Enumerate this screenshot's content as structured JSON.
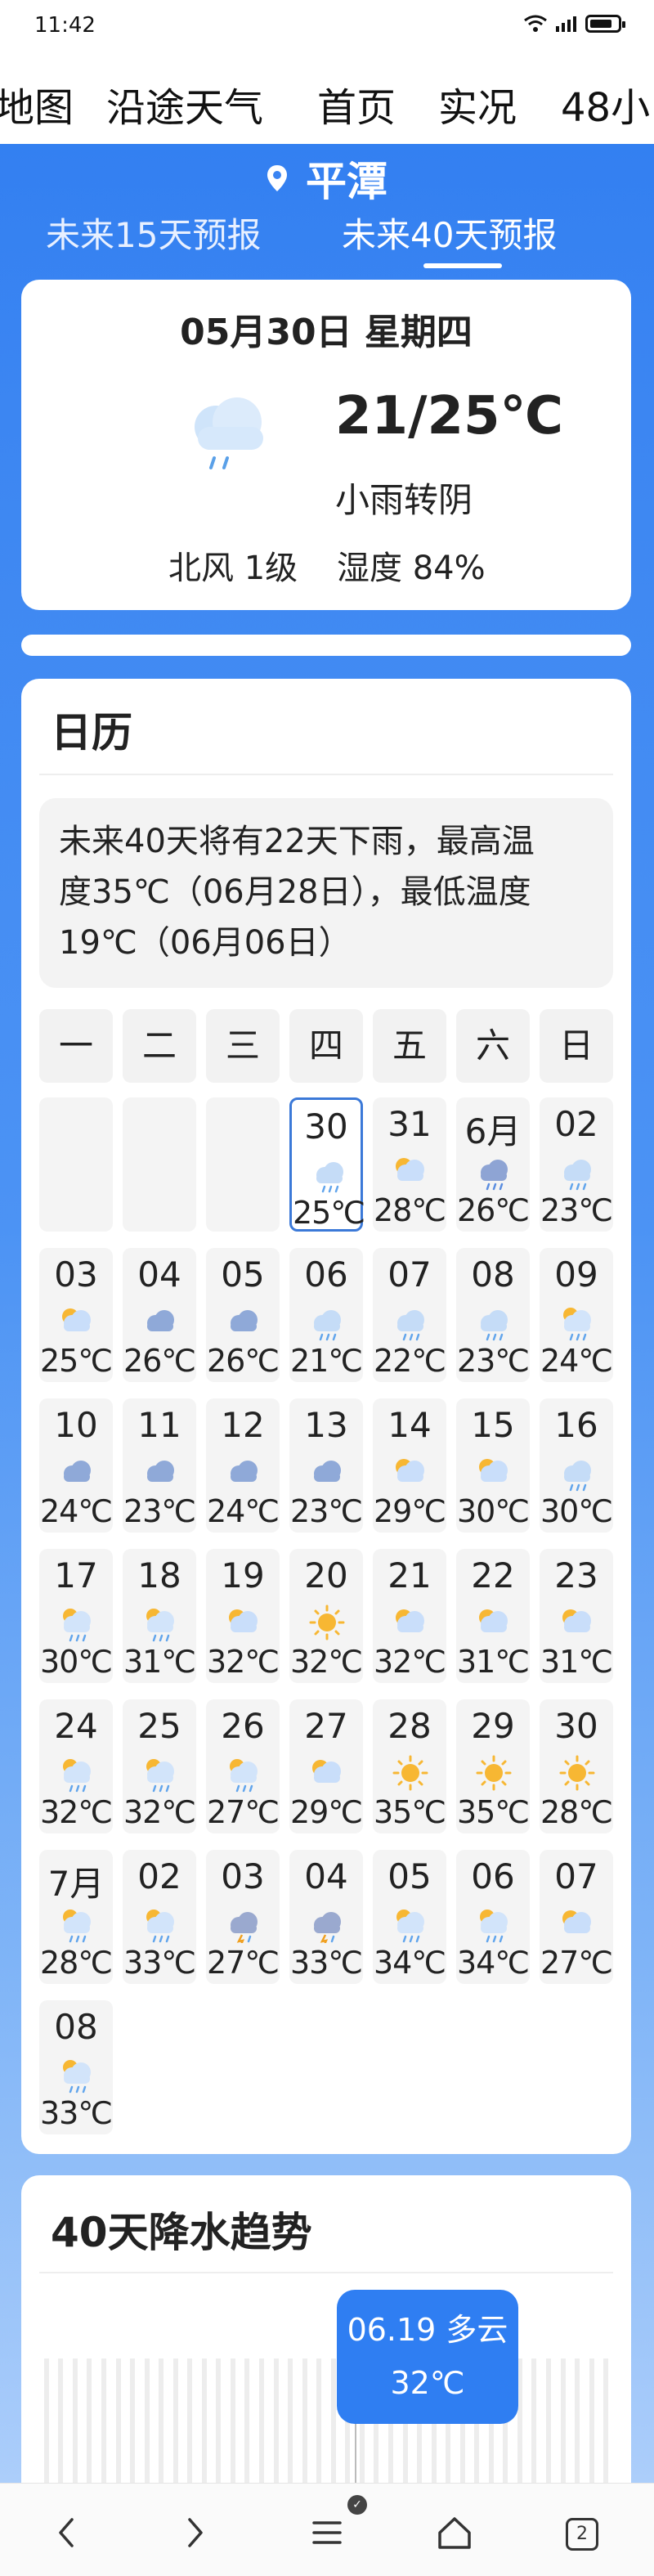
{
  "status_bar": {
    "time": "11:42"
  },
  "top_tabs": [
    "地图",
    "沿途天气",
    "首页",
    "实况",
    "48小"
  ],
  "location": "平潭",
  "forecast_tabs": [
    "未来15天预报",
    "未来40天预报"
  ],
  "today": {
    "date": "05月30日 星期四",
    "temp": "21/25℃",
    "condition": "小雨转阴",
    "wind": "北风 1级",
    "humidity": "湿度 84%",
    "icon": "light-rain-icon"
  },
  "calendar": {
    "title": "日历",
    "summary": "未来40天将有22天下雨，最高温度35℃（06月28日），最低温度19℃（06月06日）",
    "summary_lines": [
      "未来40天将有22天下雨，最高温",
      "度35℃（06月28日），最低温度",
      "19℃（06月06日）"
    ],
    "weekdays": [
      "一",
      "二",
      "三",
      "四",
      "五",
      "六",
      "日"
    ],
    "leading_empty": 3,
    "days": [
      {
        "label": "30",
        "temp": "25℃",
        "icon": "light-rain-icon",
        "selected": true
      },
      {
        "label": "31",
        "temp": "28℃",
        "icon": "partly-cloudy-icon"
      },
      {
        "label": "6月",
        "temp": "26℃",
        "icon": "rain-icon"
      },
      {
        "label": "02",
        "temp": "23℃",
        "icon": "light-rain-icon"
      },
      {
        "label": "03",
        "temp": "25℃",
        "icon": "partly-cloudy-icon"
      },
      {
        "label": "04",
        "temp": "26℃",
        "icon": "cloudy-icon"
      },
      {
        "label": "05",
        "temp": "26℃",
        "icon": "cloudy-icon"
      },
      {
        "label": "06",
        "temp": "21℃",
        "icon": "light-rain-icon"
      },
      {
        "label": "07",
        "temp": "22℃",
        "icon": "light-rain-icon"
      },
      {
        "label": "08",
        "temp": "23℃",
        "icon": "light-rain-icon"
      },
      {
        "label": "09",
        "temp": "24℃",
        "icon": "sun-rain-icon"
      },
      {
        "label": "10",
        "temp": "24℃",
        "icon": "cloudy-icon"
      },
      {
        "label": "11",
        "temp": "23℃",
        "icon": "cloudy-icon"
      },
      {
        "label": "12",
        "temp": "24℃",
        "icon": "cloudy-icon"
      },
      {
        "label": "13",
        "temp": "23℃",
        "icon": "cloudy-icon"
      },
      {
        "label": "14",
        "temp": "29℃",
        "icon": "partly-cloudy-icon"
      },
      {
        "label": "15",
        "temp": "30℃",
        "icon": "partly-cloudy-icon"
      },
      {
        "label": "16",
        "temp": "30℃",
        "icon": "light-rain-icon"
      },
      {
        "label": "17",
        "temp": "30℃",
        "icon": "sun-rain-icon"
      },
      {
        "label": "18",
        "temp": "31℃",
        "icon": "sun-rain-icon"
      },
      {
        "label": "19",
        "temp": "32℃",
        "icon": "partly-cloudy-icon"
      },
      {
        "label": "20",
        "temp": "32℃",
        "icon": "sun-icon"
      },
      {
        "label": "21",
        "temp": "32℃",
        "icon": "partly-cloudy-icon"
      },
      {
        "label": "22",
        "temp": "31℃",
        "icon": "partly-cloudy-icon"
      },
      {
        "label": "23",
        "temp": "31℃",
        "icon": "partly-cloudy-icon"
      },
      {
        "label": "24",
        "temp": "32℃",
        "icon": "sun-rain-icon"
      },
      {
        "label": "25",
        "temp": "32℃",
        "icon": "sun-rain-icon"
      },
      {
        "label": "26",
        "temp": "27℃",
        "icon": "sun-rain-icon"
      },
      {
        "label": "27",
        "temp": "29℃",
        "icon": "partly-cloudy-icon"
      },
      {
        "label": "28",
        "temp": "35℃",
        "icon": "sun-icon"
      },
      {
        "label": "29",
        "temp": "35℃",
        "icon": "sun-icon"
      },
      {
        "label": "30",
        "temp": "28℃",
        "icon": "sun-icon"
      },
      {
        "label": "7月",
        "temp": "28℃",
        "icon": "sun-rain-icon"
      },
      {
        "label": "02",
        "temp": "33℃",
        "icon": "sun-rain-icon"
      },
      {
        "label": "03",
        "temp": "27℃",
        "icon": "thunderstorm-icon"
      },
      {
        "label": "04",
        "temp": "33℃",
        "icon": "thunderstorm-icon"
      },
      {
        "label": "05",
        "temp": "34℃",
        "icon": "sun-rain-icon"
      },
      {
        "label": "06",
        "temp": "34℃",
        "icon": "sun-rain-icon"
      },
      {
        "label": "07",
        "temp": "27℃",
        "icon": "partly-cloudy-icon"
      },
      {
        "label": "08",
        "temp": "33℃",
        "icon": "sun-rain-icon"
      }
    ]
  },
  "trend": {
    "title": "40天降水趋势",
    "tooltip_date": "06.19 多云",
    "tooltip_temp": "32℃",
    "rain_days": [
      true,
      true,
      true,
      false,
      false,
      true,
      true,
      true,
      false,
      true,
      false,
      false,
      false,
      true,
      true,
      false,
      false,
      false,
      false,
      false,
      false,
      false,
      false,
      true,
      true,
      true,
      false,
      false,
      false,
      true,
      true,
      true,
      true,
      true,
      true,
      true,
      false,
      false,
      false,
      true
    ]
  },
  "nav": {
    "tab_count": "2"
  },
  "colors": {
    "accent": "#2f7ef2",
    "rain_dot": "#1e6fe5"
  }
}
